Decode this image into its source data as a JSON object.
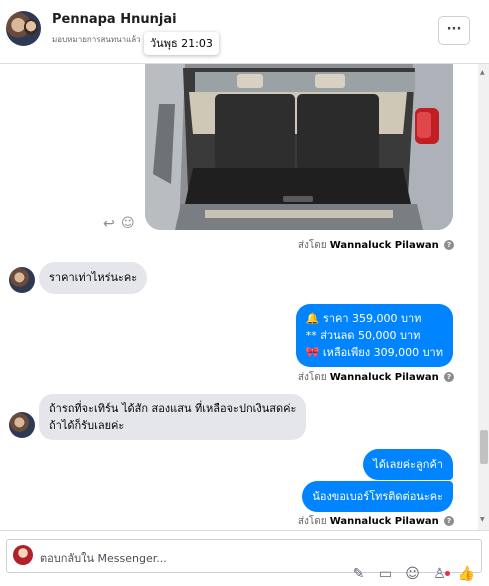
{
  "header": {
    "contact_name": "Pennapa Hnunjai",
    "subtitle": "มอบหมายการสนทนาแล้ว",
    "time_tooltip": "วันพุธ 21:03",
    "more_label": "···"
  },
  "icons": {
    "reply": "reply-icon",
    "react": "emoji-react-icon",
    "info": "info-icon",
    "more": "more-options-icon",
    "attach": "paperclip-icon",
    "gif": "gif-icon",
    "emoji": "emoji-icon",
    "sticker": "sticker-icon",
    "like": "thumbs-up-icon"
  },
  "colors": {
    "outgoing_bubble": "#0084ff",
    "incoming_bubble": "#e4e6eb",
    "notification_dot": "#f02849"
  },
  "messages": {
    "sent_by_prefix": "ส่งโดย",
    "sender": "Wannaluck Pilawan",
    "in1": "ราคาเท่าไหร่นะคะ",
    "out1_line1": "🔔 ราคา 359,000 บาท",
    "out1_line2": "** ส่วนลด 50,000 บาท",
    "out1_line3": "🎀 เหลือเพียง 309,000 บาท",
    "in2_line1": "ถ้ารถที่จะเทิร์น ได้สัก สองแสน ที่เหลือจะปกเงินสดค่ะ",
    "in2_line2": "ถ้าได้ก็รับเลยค่ะ",
    "out2": "ได้เลยค่ะลูกค้า",
    "out3": "น้องขอเบอร์โทรติดต่อนะคะ"
  },
  "composer": {
    "placeholder": "ตอบกลับใน Messenger..."
  }
}
